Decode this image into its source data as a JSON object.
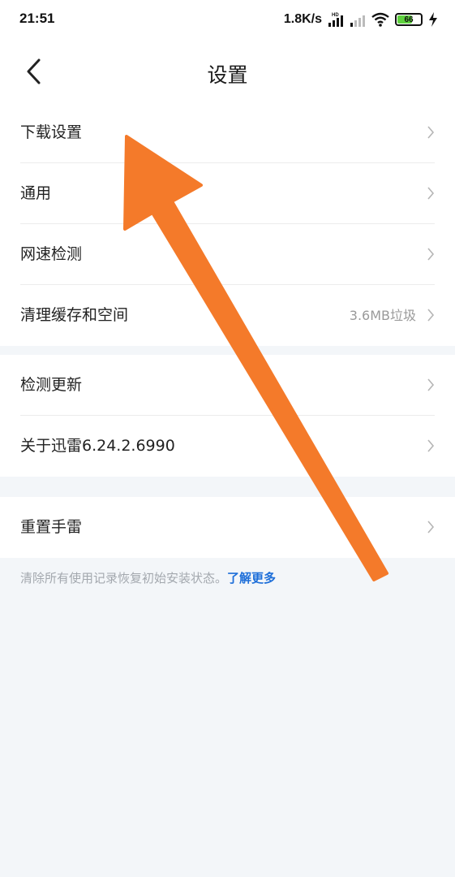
{
  "status_bar": {
    "time": "21:51",
    "net_speed": "1.8K/s",
    "battery_level": "66",
    "battery_fill_percent": 66
  },
  "header": {
    "title": "设置",
    "back_icon": "chevron-left-icon"
  },
  "groups": [
    {
      "items": [
        {
          "label": "下载设置",
          "value": ""
        },
        {
          "label": "通用",
          "value": ""
        },
        {
          "label": "网速检测",
          "value": ""
        },
        {
          "label": "清理缓存和空间",
          "value": "3.6MB垃圾"
        }
      ]
    },
    {
      "items": [
        {
          "label": "检测更新",
          "value": ""
        },
        {
          "label": "关于迅雷6.24.2.6990",
          "value": ""
        }
      ]
    },
    {
      "items": [
        {
          "label": "重置手雷",
          "value": ""
        }
      ]
    }
  ],
  "footer": {
    "note": "清除所有使用记录恢复初始安装状态。",
    "link": "了解更多"
  },
  "colors": {
    "accent_link": "#1e6fd9",
    "annotation_arrow": "#f47a2a",
    "battery_green": "#5ed13e"
  }
}
